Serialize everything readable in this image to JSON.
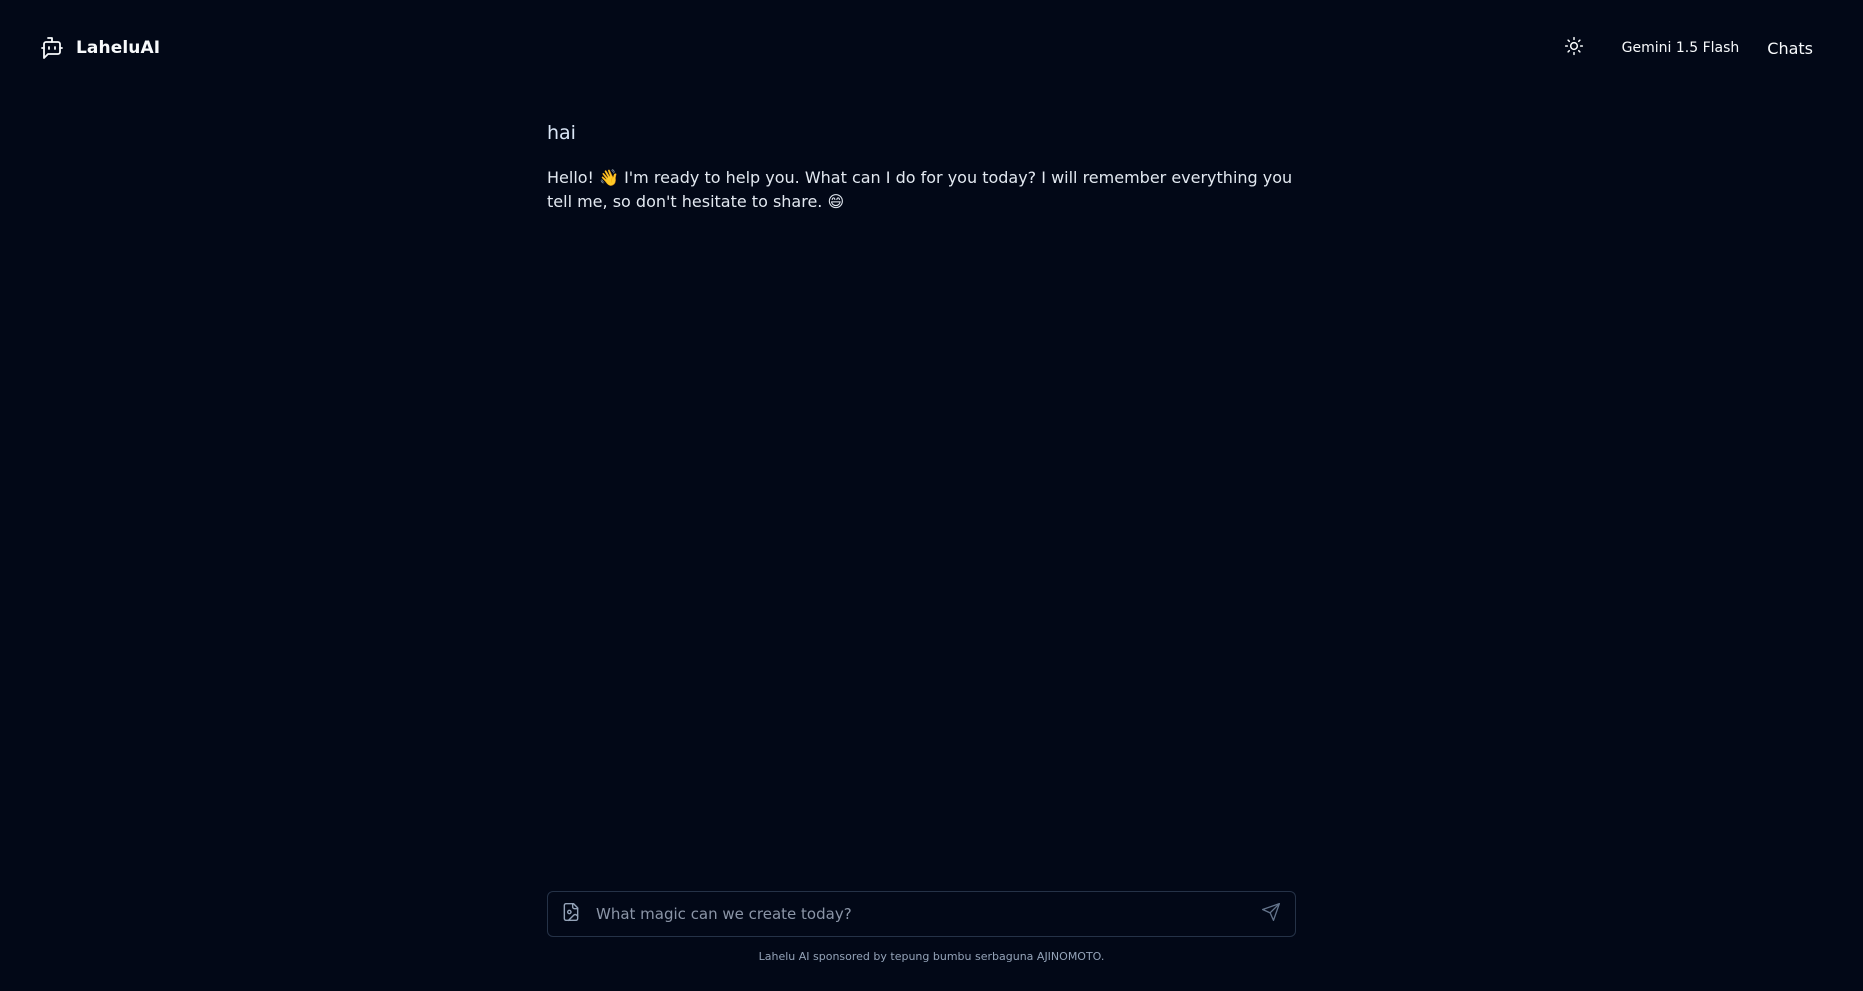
{
  "app": {
    "name": "LaheluAI",
    "logo_icon": "bot-message-icon"
  },
  "header": {
    "theme_toggle_icon": "sun-icon",
    "model": "Gemini 1.5 Flash",
    "chats_label": "Chats"
  },
  "conversation": {
    "user_message": "hai",
    "assistant_message": "Hello! 👋 I'm ready to help you. What can I do for you today? I will remember everything you tell me, so don't hesitate to share. 😄"
  },
  "composer": {
    "placeholder": "What magic can we create today?",
    "value": "",
    "attach_icon": "image-file-icon",
    "send_icon": "send-icon"
  },
  "footer": {
    "note": "Lahelu AI sponsored by tepung bumbu serbaguna AJINOMOTO."
  },
  "colors": {
    "background": "#020817",
    "border": "#253247",
    "text": "#f8fafc",
    "muted": "#94a3b8"
  }
}
